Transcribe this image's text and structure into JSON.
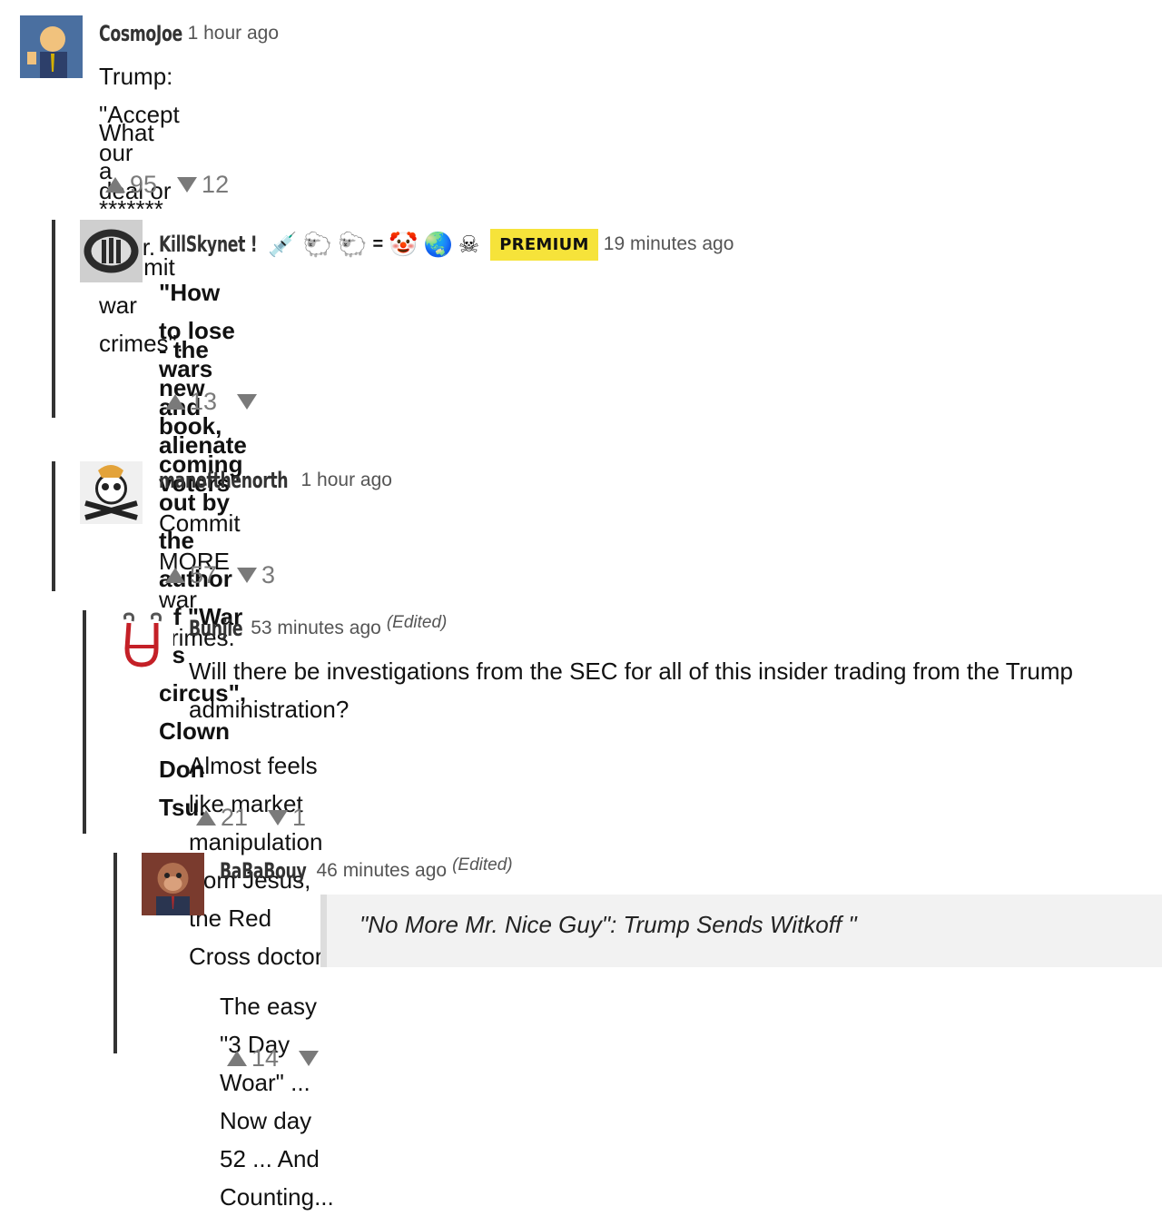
{
  "comments": [
    {
      "username": "CosmoJoe",
      "time": "1 hour ago",
      "paragraphs": [
        "Trump:  \"Accept our deal or we commit war crimes\".",
        "What a ******* loser."
      ],
      "upvotes": "95",
      "downvotes": "12"
    },
    {
      "username": "KillSkynet !",
      "badges": [
        "💉",
        "🐑",
        "🐑",
        "=",
        "🤡",
        "🌏",
        "☠"
      ],
      "premium": "PREMIUM",
      "time": "19 minutes ago",
      "paragraphs": [
        "\"How to lose wars and alienate voters\"",
        "- the new book, coming out by the author of \"War as circus\", Clown Don Tsu."
      ],
      "upvotes": "13",
      "downvotes": ""
    },
    {
      "username": "manofthenorth",
      "time": "1 hour ago",
      "paragraphs": [
        "Commit MORE war crimes."
      ],
      "upvotes": "57",
      "downvotes": "3"
    },
    {
      "username": "Bunjie",
      "time": "53 minutes ago",
      "edited": "(Edited)",
      "paragraphs": [
        "Will there be investigations from the SEC for all of this insider trading from the Trump administration?",
        "Almost feels like market manipulation from Jesus, the Red Cross doctor"
      ],
      "upvotes": "21",
      "downvotes": "1"
    },
    {
      "username": "BaBaBouy",
      "time": "46 minutes ago",
      "edited": "(Edited)",
      "quote": "\"No More Mr. Nice Guy\": Trump Sends Witkoff \"",
      "paragraphs": [
        "The easy \"3 Day Woar\" ... Now day 52 ... And Counting..."
      ],
      "upvotes": "14",
      "downvotes": ""
    }
  ]
}
